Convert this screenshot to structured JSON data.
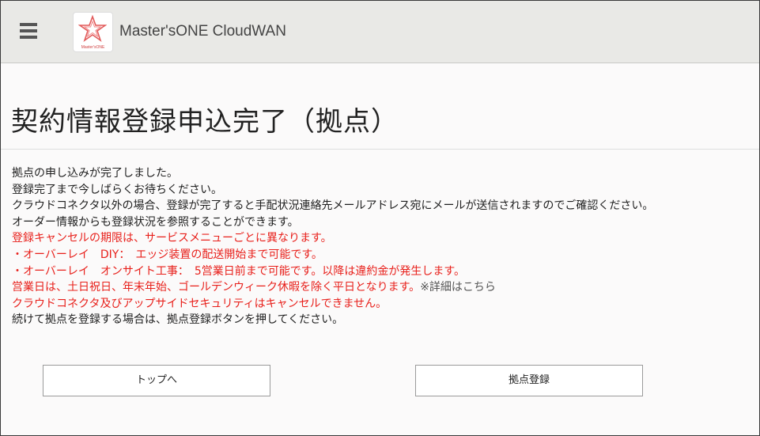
{
  "header": {
    "app_title": "Master'sONE CloudWAN",
    "logo_text": "Master'sONE",
    "menu_icon": "hamburger-menu-icon",
    "logo_icon": "star-logo-icon"
  },
  "page": {
    "title": "契約情報登録申込完了（拠点）"
  },
  "messages": {
    "line1": "拠点の申し込みが完了しました。",
    "line2": "登録完了まで今しばらくお待ちください。",
    "line3": "クラウドコネクタ以外の場合、登録が完了すると手配状況連絡先メールアドレス宛にメールが送信されますのでご確認ください。",
    "line4": "オーダー情報からも登録状況を参照することができます。",
    "line5": "登録キャンセルの期限は、サービスメニューごとに異なります。",
    "line6": "・オーバーレイ　DIY：　エッジ装置の配送開始まで可能です。",
    "line7": "・オーバーレイ　オンサイト工事：　5営業日前まで可能です。以降は違約金が発生します。",
    "line8": "営業日は、土日祝日、年末年始、ゴールデンウィーク休暇を除く平日となります。",
    "line8_link": "※詳細はこちら",
    "line9": "クラウドコネクタ及びアップサイドセキュリティはキャンセルできません。",
    "line10": "続けて拠点を登録する場合は、拠点登録ボタンを押してください。"
  },
  "buttons": {
    "top_label": "トップへ",
    "register_label": "拠点登録"
  },
  "colors": {
    "alert": "#e8201b",
    "header_bg": "#e9e9e6",
    "page_bg": "#fbfafa"
  }
}
